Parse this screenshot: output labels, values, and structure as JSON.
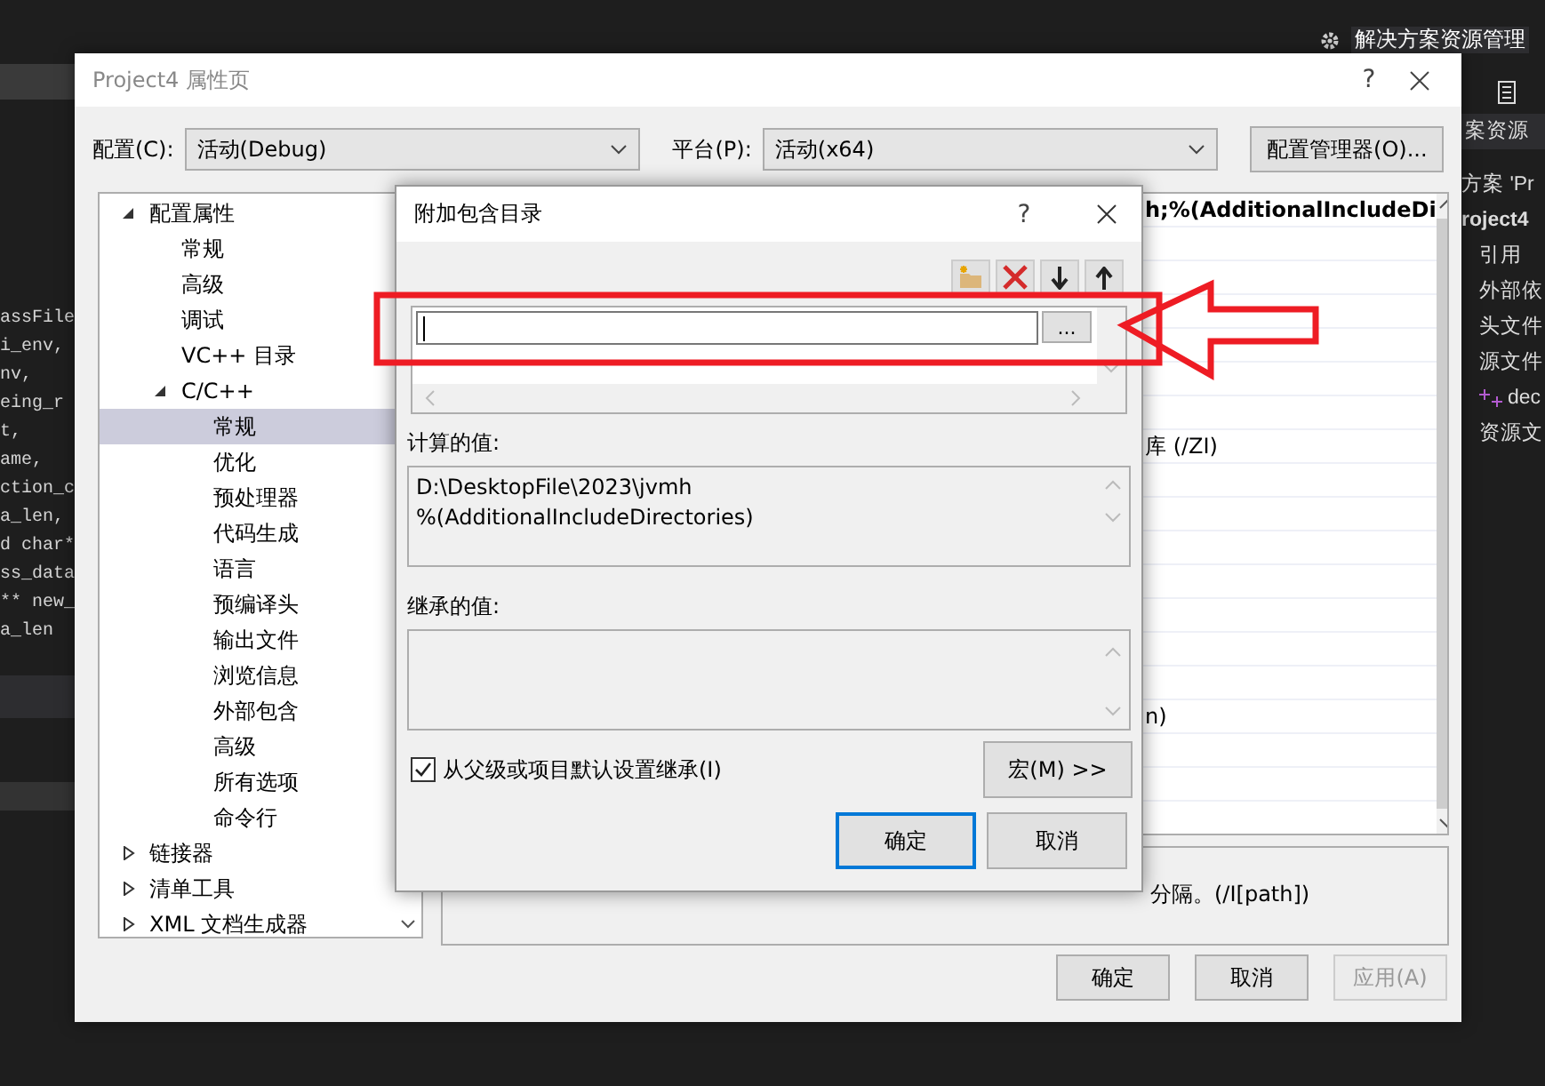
{
  "editor": {
    "code_lines": [
      "assFile",
      "i_env,",
      "nv,",
      "eing_r",
      "t,",
      "ame,",
      "ction_c",
      "a_len,",
      "d char*",
      "ss_data",
      "** new_",
      "a_len"
    ]
  },
  "solution_explorer": {
    "tab_title": "解决方案资源管理",
    "header": "案资源",
    "items": [
      {
        "label": "方案 'Pr",
        "bold": false
      },
      {
        "label": "roject4",
        "bold": true
      },
      {
        "label": "引用",
        "bold": false
      },
      {
        "label": "外部依",
        "bold": false
      },
      {
        "label": "头文件",
        "bold": false
      },
      {
        "label": "源文件",
        "bold": false
      },
      {
        "label": "dec",
        "bold": false
      },
      {
        "label": "资源文",
        "bold": false
      }
    ]
  },
  "property_dialog": {
    "title": "Project4 属性页",
    "help": "?",
    "config_label": "配置(C):",
    "config_value": "活动(Debug)",
    "platform_label": "平台(P):",
    "platform_value": "活动(x64)",
    "config_manager_button": "配置管理器(O)...",
    "tree": [
      {
        "label": "配置属性",
        "expanded": true,
        "selected": false,
        "children": [
          {
            "label": "常规",
            "selected": false
          },
          {
            "label": "高级",
            "selected": false
          },
          {
            "label": "调试",
            "selected": false
          },
          {
            "label": "VC++ 目录",
            "selected": false
          },
          {
            "label": "C/C++",
            "expanded": true,
            "selected": false,
            "children": [
              {
                "label": "常规",
                "selected": true
              },
              {
                "label": "优化",
                "selected": false
              },
              {
                "label": "预处理器",
                "selected": false
              },
              {
                "label": "代码生成",
                "selected": false
              },
              {
                "label": "语言",
                "selected": false
              },
              {
                "label": "预编译头",
                "selected": false
              },
              {
                "label": "输出文件",
                "selected": false
              },
              {
                "label": "浏览信息",
                "selected": false
              },
              {
                "label": "外部包含",
                "selected": false
              },
              {
                "label": "高级",
                "selected": false
              },
              {
                "label": "所有选项",
                "selected": false
              },
              {
                "label": "命令行",
                "selected": false
              }
            ]
          }
        ]
      },
      {
        "label": "链接器",
        "expanded": false,
        "selected": false
      },
      {
        "label": "清单工具",
        "expanded": false,
        "selected": false
      },
      {
        "label": "XML 文档生成器",
        "expanded": false,
        "selected": false
      }
    ],
    "property_rows": [
      {
        "value": "h;%(AdditionalIncludeDi",
        "bold": true
      },
      {
        "value": "库 (/ZI)",
        "bold": false
      },
      {
        "value": "n)",
        "bold": false
      }
    ],
    "description": "分隔。(/I[path])",
    "buttons": [
      {
        "label": "确定",
        "disabled": false
      },
      {
        "label": "取消",
        "disabled": false
      },
      {
        "label": "应用(A)",
        "disabled": true
      }
    ]
  },
  "include_dialog": {
    "title": "附加包含目录",
    "help": "?",
    "browse_button": "...",
    "computed_label": "计算的值:",
    "computed_lines": [
      "D:\\DesktopFile\\2023\\jvmh",
      "%(AdditionalIncludeDirectories)"
    ],
    "inherited_label": "继承的值:",
    "inherit_checkbox": {
      "label": "从父级或项目默认设置继承(I)",
      "checked": true
    },
    "macro_button": "宏(M) >>",
    "ok_button": "确定",
    "cancel_button": "取消"
  }
}
